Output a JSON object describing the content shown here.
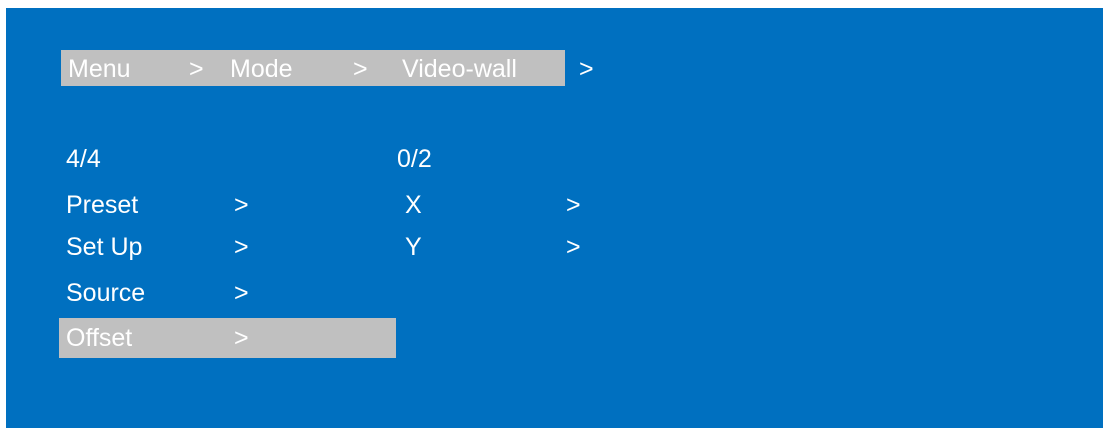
{
  "breadcrumb": {
    "items": [
      "Menu",
      "Mode",
      "Video-wall"
    ],
    "separator": ">",
    "trailing": ">"
  },
  "left_column": {
    "counter": "4/4",
    "items": [
      {
        "label": "Preset",
        "arrow": ">"
      },
      {
        "label": "Set Up",
        "arrow": ">"
      },
      {
        "label": "Source",
        "arrow": ">"
      },
      {
        "label": "Offset",
        "arrow": ">"
      }
    ],
    "selected_index": 3
  },
  "right_column": {
    "counter": "0/2",
    "items": [
      {
        "label": "X",
        "arrow": ">"
      },
      {
        "label": "Y",
        "arrow": ">"
      }
    ]
  },
  "colors": {
    "background": "#0070c0",
    "highlight": "#c0c0c0",
    "text": "#ffffff"
  }
}
